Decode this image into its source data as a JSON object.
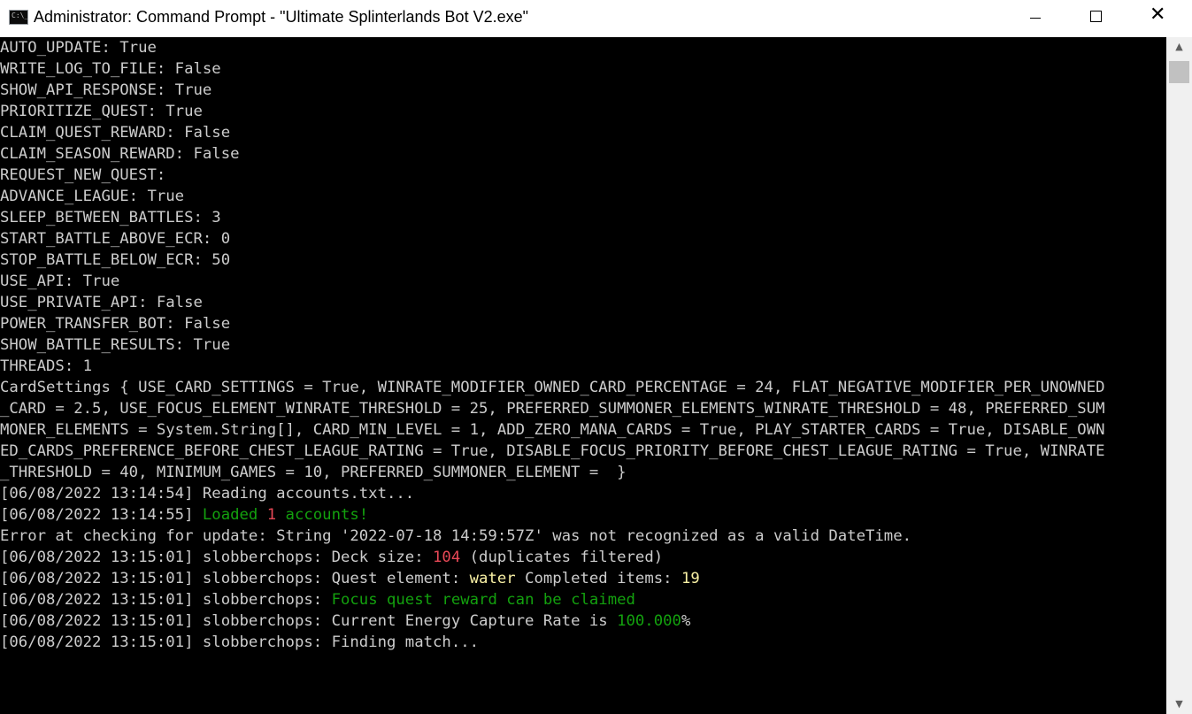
{
  "window": {
    "title": "Administrator: Command Prompt - \"Ultimate Splinterlands Bot V2.exe\"",
    "icon_label": "C:\\_",
    "controls": {
      "minimize": "minimize-icon",
      "maximize": "maximize-icon",
      "close": "close-icon",
      "close_glyph": "✕"
    }
  },
  "scrollbar": {
    "up": "▲",
    "down": "▼"
  },
  "colors": {
    "default": "#cccccc",
    "green": "#13a10e",
    "red": "#e74856",
    "yellow": "#f9f1a5"
  },
  "console": {
    "settings": [
      "AUTO_UPDATE: True",
      "WRITE_LOG_TO_FILE: False",
      "SHOW_API_RESPONSE: True",
      "PRIORITIZE_QUEST: True",
      "CLAIM_QUEST_REWARD: False",
      "CLAIM_SEASON_REWARD: False",
      "REQUEST_NEW_QUEST:",
      "ADVANCE_LEAGUE: True",
      "SLEEP_BETWEEN_BATTLES: 3",
      "START_BATTLE_ABOVE_ECR: 0",
      "STOP_BATTLE_BELOW_ECR: 50",
      "USE_API: True",
      "USE_PRIVATE_API: False",
      "POWER_TRANSFER_BOT: False",
      "SHOW_BATTLE_RESULTS: True",
      "THREADS: 1"
    ],
    "card_settings": [
      "CardSettings { USE_CARD_SETTINGS = True, WINRATE_MODIFIER_OWNED_CARD_PERCENTAGE = 24, FLAT_NEGATIVE_MODIFIER_PER_UNOWNED",
      "_CARD = 2.5, USE_FOCUS_ELEMENT_WINRATE_THRESHOLD = 25, PREFERRED_SUMMONER_ELEMENTS_WINRATE_THRESHOLD = 48, PREFERRED_SUM",
      "MONER_ELEMENTS = System.String[], CARD_MIN_LEVEL = 1, ADD_ZERO_MANA_CARDS = True, PLAY_STARTER_CARDS = True, DISABLE_OWN",
      "ED_CARDS_PREFERENCE_BEFORE_CHEST_LEAGUE_RATING = True, DISABLE_FOCUS_PRIORITY_BEFORE_CHEST_LEAGUE_RATING = True, WINRATE",
      "_THRESHOLD = 40, MINIMUM_GAMES = 10, PREFERRED_SUMMONER_ELEMENT =  }"
    ],
    "log": {
      "reading": {
        "timestamp": "[06/08/2022 13:14:54]",
        "text": " Reading accounts.txt..."
      },
      "loaded": {
        "timestamp": "[06/08/2022 13:14:55]",
        "pre": " Loaded ",
        "count": "1",
        "post": " accounts!"
      },
      "error": "Error at checking for update: String '2022-07-18 14:59:57Z' was not recognized as a valid DateTime.",
      "deck": {
        "timestamp": "[06/08/2022 13:15:01]",
        "pre": " slobberchops: Deck size: ",
        "size": "104",
        "post": " (duplicates filtered)"
      },
      "quest": {
        "timestamp": "[06/08/2022 13:15:01]",
        "pre": " slobberchops: Quest element: ",
        "element": "water",
        "mid": " Completed items: ",
        "items": "19"
      },
      "focus": {
        "timestamp": "[06/08/2022 13:15:01]",
        "pre": " slobberchops: ",
        "msg": "Focus quest reward can be claimed"
      },
      "ecr": {
        "timestamp": "[06/08/2022 13:15:01]",
        "pre": " slobberchops: Current Energy Capture Rate is ",
        "value": "100.000",
        "post": "%"
      },
      "finding": {
        "timestamp": "[06/08/2022 13:15:01]",
        "text": " slobberchops: Finding match..."
      }
    }
  }
}
